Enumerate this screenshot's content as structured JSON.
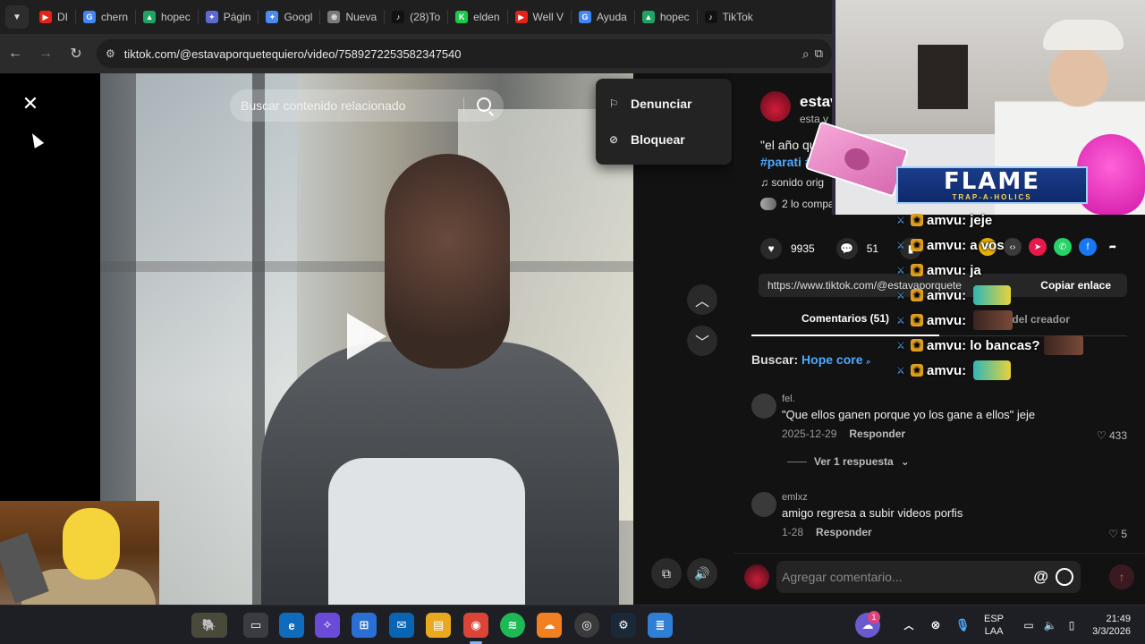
{
  "browser": {
    "tabs": [
      {
        "label": "DI",
        "color": "#e62117",
        "glyph": "▶"
      },
      {
        "label": "chern",
        "color": "#4285f4",
        "glyph": "G"
      },
      {
        "label": "hopec",
        "color": "#1fa463",
        "glyph": "▲"
      },
      {
        "label": "Págin",
        "color": "#5e6ad2",
        "glyph": "✦"
      },
      {
        "label": "Googl",
        "color": "#4c8bf5",
        "glyph": "✦"
      },
      {
        "label": "Nueva",
        "color": "#7a7a7a",
        "glyph": "⊛"
      },
      {
        "label": "(28)To",
        "color": "#111111",
        "glyph": "♪"
      },
      {
        "label": "elden",
        "color": "#19c94a",
        "glyph": "K"
      },
      {
        "label": "Well V",
        "color": "#e62117",
        "glyph": "▶"
      },
      {
        "label": "Ayuda",
        "color": "#4285f4",
        "glyph": "G"
      },
      {
        "label": "hopec",
        "color": "#1fa463",
        "glyph": "▲"
      },
      {
        "label": "TikTok",
        "color": "#111111",
        "glyph": "♪"
      }
    ],
    "url": "tiktok.com/@estavaporquetequiero/video/7589272253582347540"
  },
  "video": {
    "search_placeholder": "Buscar contenido relacionado"
  },
  "context_menu": {
    "report": "Denunciar",
    "block": "Bloquear"
  },
  "post": {
    "author": "estav",
    "author_sub": "esta v",
    "description": "\"el año que",
    "hashtag": "#parati #",
    "sound": "sonido orig",
    "shared": "2 lo compa",
    "likes": "9935",
    "comments": "51",
    "link": "https://www.tiktok.com/@estavaporquete",
    "copy_link": "Copiar enlace"
  },
  "tabs": {
    "comments": "Comentarios (51)",
    "creator": "os del creador"
  },
  "search": {
    "label": "Buscar:",
    "term": "Hope core"
  },
  "comments": [
    {
      "user": "fel.",
      "text": "\"Que ellos ganen porque yo los gane a ellos\" jeje",
      "date": "2025-12-29",
      "reply": "Responder",
      "likes": "433",
      "replies": "Ver 1 respuesta"
    },
    {
      "user": "emlxz",
      "text": "amigo regresa a subir videos porfis",
      "date": "1-28",
      "reply": "Responder",
      "likes": "5"
    }
  ],
  "comment_bar": {
    "placeholder": "Agregar comentario...",
    "at": "@"
  },
  "overlay": {
    "flame_title": "FLAME",
    "flame_sub": "TRAP-A-HOLICS",
    "chat": [
      {
        "user": "amvu:",
        "msg": "jeje"
      },
      {
        "user": "amvu:",
        "msg": "a vos"
      },
      {
        "user": "amvu:",
        "msg": "ja"
      },
      {
        "user": "amvu:",
        "msg": ""
      },
      {
        "user": "amvu:",
        "msg": ""
      },
      {
        "user": "amvu:",
        "msg": "lo bancas?"
      },
      {
        "user": "amvu:",
        "msg": ""
      }
    ]
  },
  "taskbar": {
    "lang_top": "ESP",
    "lang_bottom": "LAA",
    "time": "21:49",
    "date": "3/3/2026",
    "notification_count": "1"
  }
}
